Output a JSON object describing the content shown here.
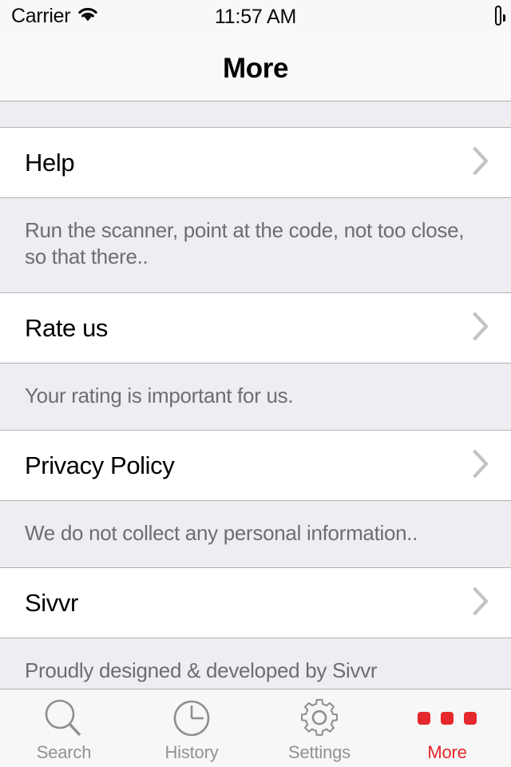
{
  "status_bar": {
    "carrier": "Carrier",
    "wifi_icon": "wifi-icon",
    "time": "11:57 AM",
    "battery_icon": "battery-full-icon"
  },
  "nav_bar": {
    "title": "More"
  },
  "scrolled_under_content": {
    "heading": "About",
    "body": "This application uses the camera of your device to read bar-code.."
  },
  "list": {
    "sections": [
      {
        "row_label": "Help",
        "accessory_icon": "chevron-right-icon",
        "footer": "Run the scanner, point at the code, not too close, so that there.."
      },
      {
        "row_label": "Rate us",
        "accessory_icon": "chevron-right-icon",
        "footer": "Your rating is important for us."
      },
      {
        "row_label": "Privacy Policy",
        "accessory_icon": "chevron-right-icon",
        "footer": "We do not collect any personal information.."
      },
      {
        "row_label": "Sivvr",
        "accessory_icon": "chevron-right-icon",
        "footer": "Proudly designed & developed by Sivvr"
      }
    ]
  },
  "tab_bar": {
    "active_index": 3,
    "active_color": "#e5282c",
    "inactive_color": "#929292",
    "items": [
      {
        "label": "Search",
        "icon": "magnifier-icon"
      },
      {
        "label": "History",
        "icon": "clock-icon"
      },
      {
        "label": "Settings",
        "icon": "gear-icon"
      },
      {
        "label": "More",
        "icon": "three-dots-icon"
      }
    ]
  }
}
